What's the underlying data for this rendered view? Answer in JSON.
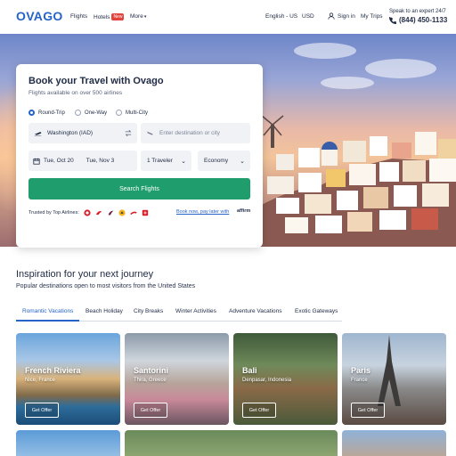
{
  "header": {
    "logo": "OVAGO",
    "nav": {
      "flights": "Flights",
      "hotels": "Hotels",
      "hotels_badge": "New",
      "more": "More"
    },
    "language": "English - US",
    "currency": "USD",
    "sign_in": "Sign in",
    "my_trips": "My Trips",
    "expert_text": "Speak to an expert 24/7",
    "phone": "(844) 450-1133"
  },
  "booking": {
    "title": "Book your Travel with Ovago",
    "subtitle": "Flights available on over 500 airlines",
    "trip_types": [
      "Round-Trip",
      "One-Way",
      "Multi-City"
    ],
    "selected_trip_type": "Round-Trip",
    "origin": "Washington (IAD)",
    "destination_placeholder": "Enter destination or city",
    "depart_date": "Tue, Oct 20",
    "return_date": "Tue, Nov 3",
    "travelers": "1 Traveler",
    "cabin": "Economy",
    "search_label": "Search Flights",
    "trusted_label": "Trusted by Top Airlines:",
    "pay_later": "Book now, pay later with",
    "affirm": "affirm"
  },
  "inspiration": {
    "title": "Inspiration for your next journey",
    "subtitle": "Popular destinations open to most visitors from the United States",
    "tabs": [
      "Romantic Vacations",
      "Beach Holiday",
      "City Breaks",
      "Winter Activities",
      "Adventure Vacations",
      "Exotic Gateways"
    ],
    "active_tab": "Romantic Vacations",
    "offer_label": "Get Offer",
    "destinations": [
      {
        "name": "French Riviera",
        "place": "Nice, France"
      },
      {
        "name": "Santorini",
        "place": "Thira, Greece"
      },
      {
        "name": "Bali",
        "place": "Denpasar, Indonesia"
      },
      {
        "name": "Paris",
        "place": "France"
      }
    ]
  },
  "colors": {
    "brand": "#2563c9",
    "search_button": "#1f9d6c",
    "badge": "#e2433a"
  }
}
